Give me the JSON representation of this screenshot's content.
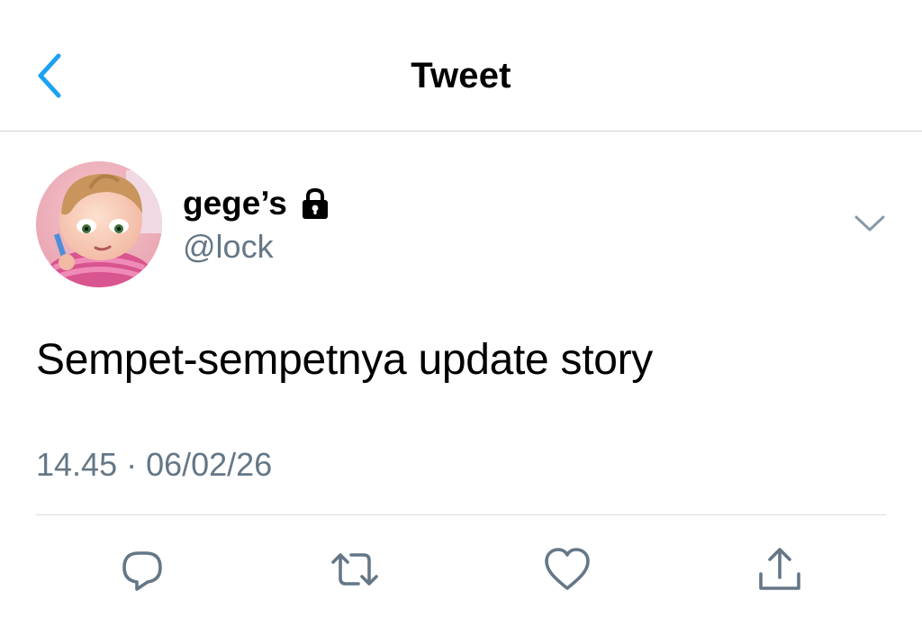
{
  "nav": {
    "title": "Tweet",
    "back_icon": "chevron-left-icon"
  },
  "tweet": {
    "display_name": "gege’s",
    "protected_icon": "lock-icon",
    "handle": "@lock",
    "text": "Sempet-sempetnya update story",
    "time": "14.45",
    "separator": "·",
    "date": "06/02/26",
    "timestamp": "14.45 · 06/02/26"
  },
  "actions": [
    {
      "name": "reply",
      "icon": "reply-icon"
    },
    {
      "name": "retweet",
      "icon": "retweet-icon"
    },
    {
      "name": "like",
      "icon": "heart-icon"
    },
    {
      "name": "share",
      "icon": "share-icon"
    }
  ],
  "colors": {
    "accent": "#1da1f2",
    "secondary_text": "#657786",
    "primary_text": "#000000",
    "divider": "#cfd5da",
    "icon_gray": "#657786"
  }
}
